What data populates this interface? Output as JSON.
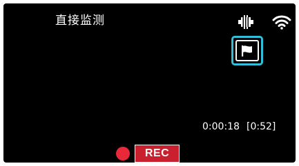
{
  "header": {
    "title": "直接监测"
  },
  "status": {
    "battery_icon": "battery-icon",
    "wifi_icon": "wifi-icon"
  },
  "controls": {
    "flag_icon": "flag-icon",
    "accent_color": "#33bfd9"
  },
  "recording": {
    "elapsed": "0:00:18",
    "remaining": "[0:52]",
    "rec_label": "REC",
    "rec_color": "#c8202e"
  }
}
